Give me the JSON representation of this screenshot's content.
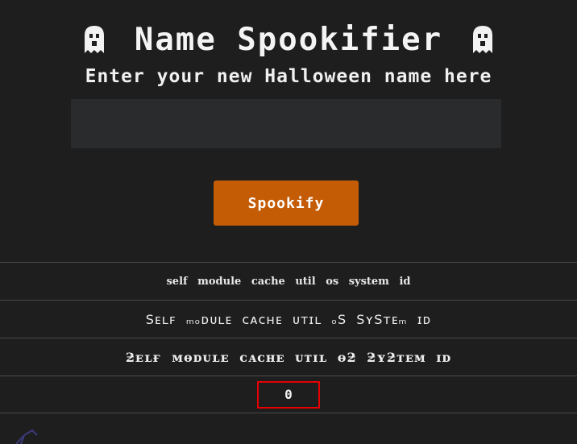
{
  "header": {
    "title": "Name Spookifier",
    "icon_left": "ghost-icon",
    "icon_right": "ghost-icon"
  },
  "subtitle": "Enter your new Halloween name here",
  "name_input": {
    "value": "",
    "placeholder": ""
  },
  "spookify_button": {
    "label": "Spookify"
  },
  "results": {
    "row1": "self module cache util os system id",
    "row2": "Sᴇʟꜰ ₘₒᴅᴜʟᴇ ᴄᴀᴄʜᴇ ᴜᴛɪʟ ₒS SʏSᴛᴇₘ ɪᴅ",
    "row3": "ƻᴇʟғ ᴍɵᴅᴜʟᴇ ᴄᴀᴄʜᴇ ᴜᴛɪʟ ɵƻ ƻʏƻᴛᴇᴍ ɪᴅ",
    "row4": "0"
  },
  "colors": {
    "background": "#1e1e1f",
    "input_background": "#2a2b2d",
    "button_background": "#c45c06",
    "highlight_border": "#e60000",
    "divider": "#4a4a4c"
  }
}
